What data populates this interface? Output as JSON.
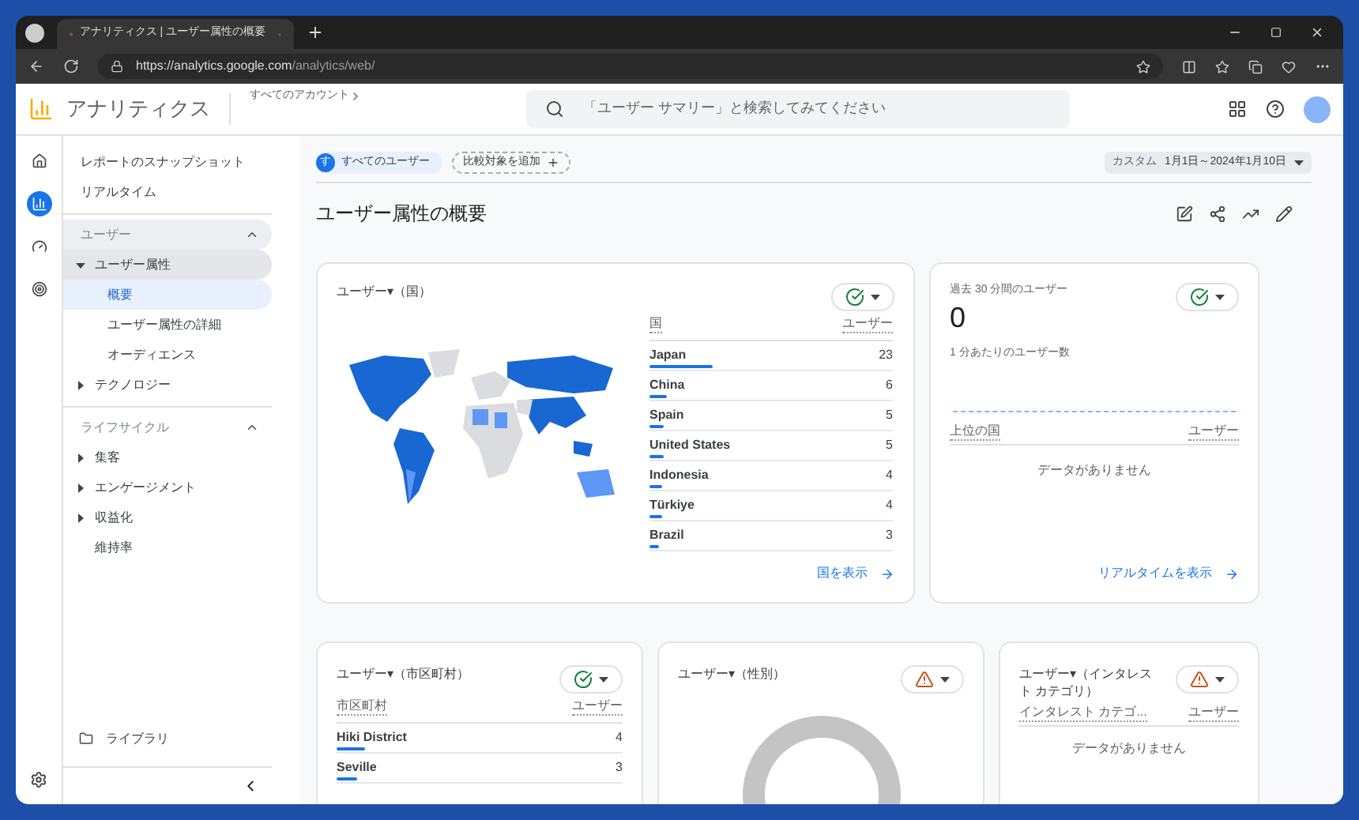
{
  "browser": {
    "tab_title": "アナリティクス | ユーザー属性の概要",
    "url_host": "https://analytics.google.com",
    "url_path": "/analytics/web/"
  },
  "header": {
    "product": "アナリティクス",
    "account": "すべてのアカウント",
    "search_placeholder": "「ユーザー サマリー」と検索してみてください"
  },
  "nav": {
    "top_links": [
      "レポートのスナップショット",
      "リアルタイム"
    ],
    "sections": [
      {
        "label": "ユーザー",
        "expanded": true,
        "active": true,
        "items": [
          {
            "label": "ユーザー属性",
            "kind": "group",
            "expanded": true,
            "active": true,
            "children": [
              {
                "label": "概要",
                "selected": true
              },
              {
                "label": "ユーザー属性の詳細",
                "selected": false
              },
              {
                "label": "オーディエンス",
                "selected": false
              }
            ]
          },
          {
            "label": "テクノロジー",
            "kind": "group",
            "expanded": false,
            "active": false
          }
        ]
      },
      {
        "label": "ライフサイクル",
        "expanded": true,
        "active": false,
        "items": [
          {
            "label": "集客",
            "kind": "group",
            "expanded": false,
            "active": false
          },
          {
            "label": "エンゲージメント",
            "kind": "group",
            "expanded": false,
            "active": false
          },
          {
            "label": "収益化",
            "kind": "group",
            "expanded": false,
            "active": false
          },
          {
            "label": "維持率",
            "kind": "link",
            "active": false
          }
        ]
      }
    ],
    "library": "ライブラリ"
  },
  "filters": {
    "segment_initial": "す",
    "segment": "すべてのユーザー",
    "compare": "比較対象を追加",
    "date_label": "カスタム",
    "date_range": "1月1日～2024年1月10日"
  },
  "page_title": "ユーザー属性の概要",
  "country_card": {
    "title": "ユーザー▾（国）",
    "ok": true,
    "columns": [
      "国",
      "ユーザー"
    ],
    "rows": [
      {
        "name": "Japan",
        "value": "23",
        "level": 0.26
      },
      {
        "name": "China",
        "value": "6",
        "level": 0.07
      },
      {
        "name": "Spain",
        "value": "5",
        "level": 0.06
      },
      {
        "name": "United States",
        "value": "5",
        "level": 0.06
      },
      {
        "name": "Indonesia",
        "value": "4",
        "level": 0.05
      },
      {
        "name": "Türkiye",
        "value": "4",
        "level": 0.05
      },
      {
        "name": "Brazil",
        "value": "3",
        "level": 0.04
      }
    ],
    "link": "国を表示"
  },
  "realtime_card": {
    "title": "過去 30 分間のユーザー",
    "ok": true,
    "value": "0",
    "subtitle": "1 分あたりのユーザー数",
    "columns": [
      "上位の国",
      "ユーザー"
    ],
    "empty": "データがありません",
    "link": "リアルタイムを表示"
  },
  "city_card": {
    "title": "ユーザー▾（市区町村）",
    "ok": true,
    "columns": [
      "市区町村",
      "ユーザー"
    ],
    "rows": [
      {
        "name": "Hiki District",
        "value": "4",
        "level": 0.1
      },
      {
        "name": "Seville",
        "value": "3",
        "level": 0.07
      }
    ]
  },
  "gender_card": {
    "title": "ユーザー▾（性別）",
    "ok": false
  },
  "interest_card": {
    "title": "ユーザー▾（インタレスト カテゴリ）",
    "ok": false,
    "columns": [
      "インタレスト カテゴ...",
      "ユーザー"
    ],
    "empty": "データがありません"
  }
}
